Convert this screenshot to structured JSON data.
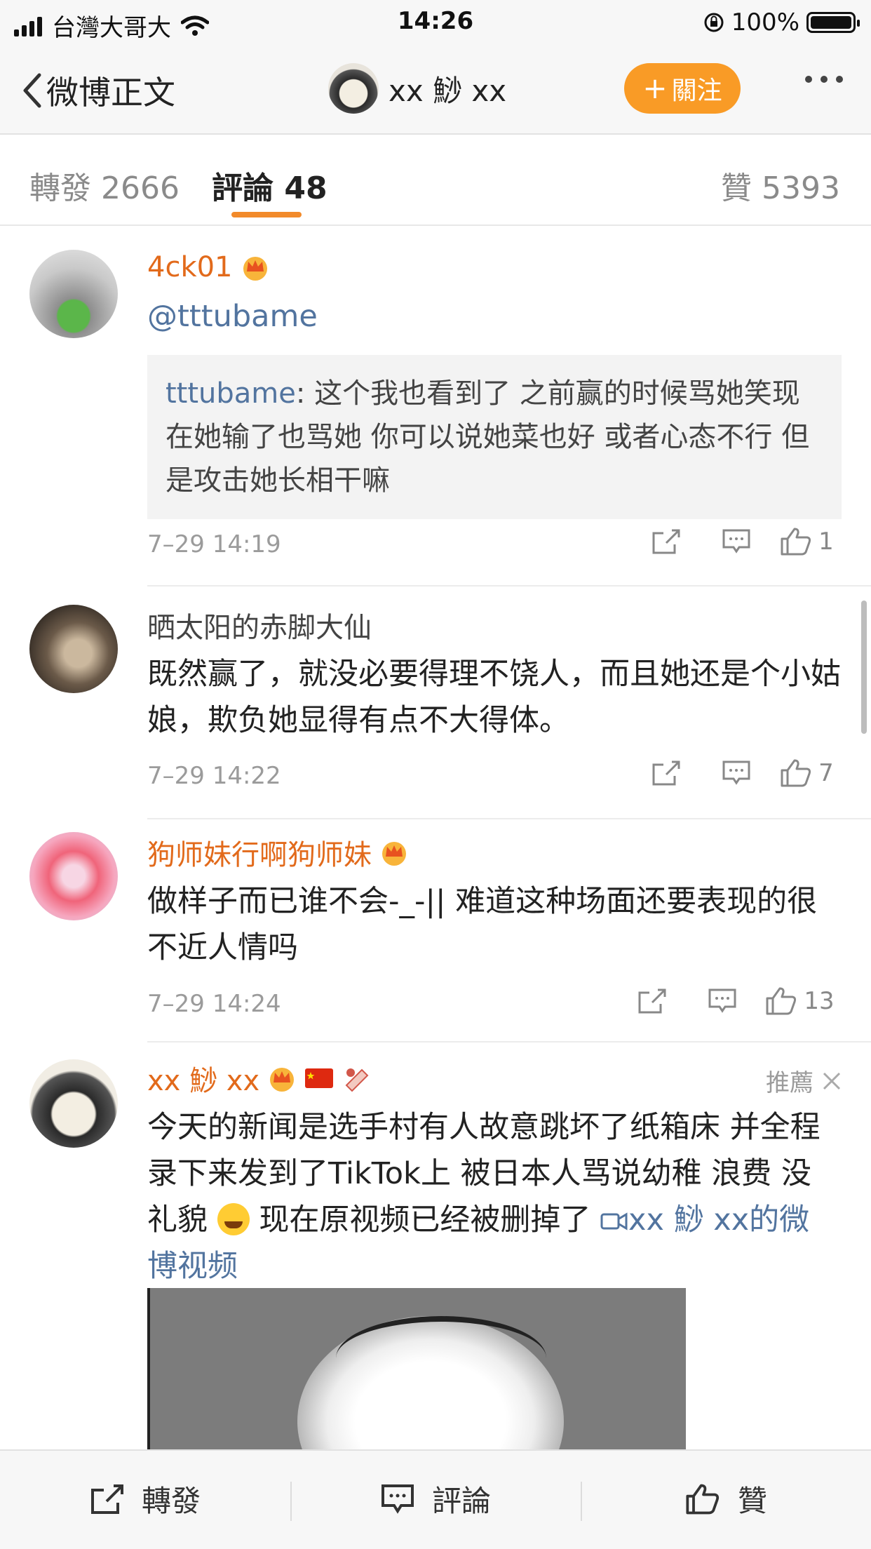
{
  "status_bar": {
    "carrier": "台灣大哥大",
    "time": "14:26",
    "battery": "100%"
  },
  "nav": {
    "back_label": "微博正文",
    "author": "xx 鯋 xx",
    "follow_label": "關注"
  },
  "tabs": {
    "forward": {
      "label": "轉發",
      "count": "2666"
    },
    "comment": {
      "label": "評論",
      "count": "48"
    },
    "like": {
      "label": "贊",
      "count": "5393"
    }
  },
  "comments": [
    {
      "name": "4ck01",
      "mention": "@tttubame",
      "quote_name": "tttubame",
      "quote_text": ": 这个我也看到了 之前赢的时候骂她笑现在她输了也骂她 你可以说她菜也好 或者心态不行 但是攻击她长相干嘛",
      "time": "7–29 14:19",
      "likes": "1"
    },
    {
      "name": "晒太阳的赤脚大仙",
      "text": "既然赢了，就没必要得理不饶人，而且她还是个小姑娘，欺负她显得有点不大得体。",
      "time": "7–29 14:22",
      "likes": "7"
    },
    {
      "name": "狗师妹行啊狗师妹",
      "text": "做样子而已谁不会-_-|| 难道这种场面还要表现的很不近人情吗",
      "time": "7–29 14:24",
      "likes": "13"
    },
    {
      "name": "xx 鯋 xx",
      "recommend": "推薦",
      "text": "今天的新闻是选手村有人故意跳坏了纸箱床 并全程录下来发到了TikTok上 被日本人骂说幼稚 浪费 没礼貌",
      "text_after_emoji": " 现在原视频已经被删掉了 ",
      "video_link": "xx 鯋 xx的微博视频"
    }
  ],
  "bottom_bar": {
    "forward": "轉發",
    "comment": "評論",
    "like": "贊"
  },
  "colors": {
    "accent": "#f99b26",
    "vip_name": "#e26a1b",
    "link": "#52749f",
    "tab_underline": "#f28a2a"
  }
}
